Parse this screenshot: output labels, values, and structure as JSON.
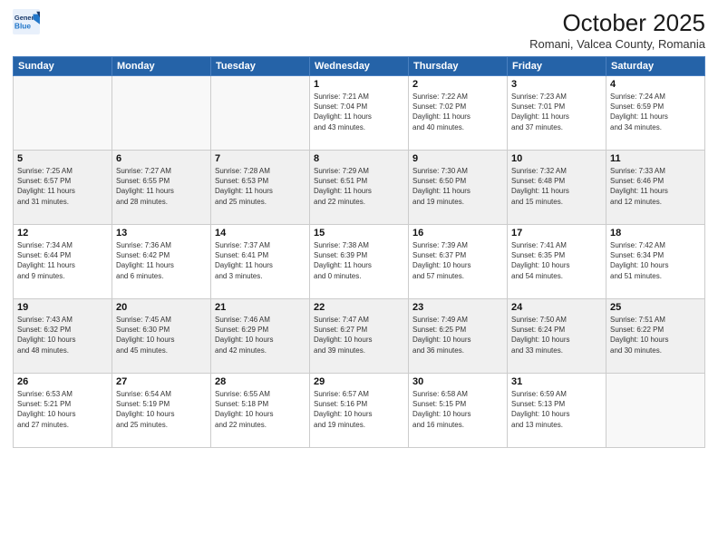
{
  "logo": {
    "line1": "General",
    "line2": "Blue"
  },
  "title": "October 2025",
  "subtitle": "Romani, Valcea County, Romania",
  "weekdays": [
    "Sunday",
    "Monday",
    "Tuesday",
    "Wednesday",
    "Thursday",
    "Friday",
    "Saturday"
  ],
  "weeks": [
    [
      {
        "day": "",
        "info": ""
      },
      {
        "day": "",
        "info": ""
      },
      {
        "day": "",
        "info": ""
      },
      {
        "day": "1",
        "info": "Sunrise: 7:21 AM\nSunset: 7:04 PM\nDaylight: 11 hours\nand 43 minutes."
      },
      {
        "day": "2",
        "info": "Sunrise: 7:22 AM\nSunset: 7:02 PM\nDaylight: 11 hours\nand 40 minutes."
      },
      {
        "day": "3",
        "info": "Sunrise: 7:23 AM\nSunset: 7:01 PM\nDaylight: 11 hours\nand 37 minutes."
      },
      {
        "day": "4",
        "info": "Sunrise: 7:24 AM\nSunset: 6:59 PM\nDaylight: 11 hours\nand 34 minutes."
      }
    ],
    [
      {
        "day": "5",
        "info": "Sunrise: 7:25 AM\nSunset: 6:57 PM\nDaylight: 11 hours\nand 31 minutes."
      },
      {
        "day": "6",
        "info": "Sunrise: 7:27 AM\nSunset: 6:55 PM\nDaylight: 11 hours\nand 28 minutes."
      },
      {
        "day": "7",
        "info": "Sunrise: 7:28 AM\nSunset: 6:53 PM\nDaylight: 11 hours\nand 25 minutes."
      },
      {
        "day": "8",
        "info": "Sunrise: 7:29 AM\nSunset: 6:51 PM\nDaylight: 11 hours\nand 22 minutes."
      },
      {
        "day": "9",
        "info": "Sunrise: 7:30 AM\nSunset: 6:50 PM\nDaylight: 11 hours\nand 19 minutes."
      },
      {
        "day": "10",
        "info": "Sunrise: 7:32 AM\nSunset: 6:48 PM\nDaylight: 11 hours\nand 15 minutes."
      },
      {
        "day": "11",
        "info": "Sunrise: 7:33 AM\nSunset: 6:46 PM\nDaylight: 11 hours\nand 12 minutes."
      }
    ],
    [
      {
        "day": "12",
        "info": "Sunrise: 7:34 AM\nSunset: 6:44 PM\nDaylight: 11 hours\nand 9 minutes."
      },
      {
        "day": "13",
        "info": "Sunrise: 7:36 AM\nSunset: 6:42 PM\nDaylight: 11 hours\nand 6 minutes."
      },
      {
        "day": "14",
        "info": "Sunrise: 7:37 AM\nSunset: 6:41 PM\nDaylight: 11 hours\nand 3 minutes."
      },
      {
        "day": "15",
        "info": "Sunrise: 7:38 AM\nSunset: 6:39 PM\nDaylight: 11 hours\nand 0 minutes."
      },
      {
        "day": "16",
        "info": "Sunrise: 7:39 AM\nSunset: 6:37 PM\nDaylight: 10 hours\nand 57 minutes."
      },
      {
        "day": "17",
        "info": "Sunrise: 7:41 AM\nSunset: 6:35 PM\nDaylight: 10 hours\nand 54 minutes."
      },
      {
        "day": "18",
        "info": "Sunrise: 7:42 AM\nSunset: 6:34 PM\nDaylight: 10 hours\nand 51 minutes."
      }
    ],
    [
      {
        "day": "19",
        "info": "Sunrise: 7:43 AM\nSunset: 6:32 PM\nDaylight: 10 hours\nand 48 minutes."
      },
      {
        "day": "20",
        "info": "Sunrise: 7:45 AM\nSunset: 6:30 PM\nDaylight: 10 hours\nand 45 minutes."
      },
      {
        "day": "21",
        "info": "Sunrise: 7:46 AM\nSunset: 6:29 PM\nDaylight: 10 hours\nand 42 minutes."
      },
      {
        "day": "22",
        "info": "Sunrise: 7:47 AM\nSunset: 6:27 PM\nDaylight: 10 hours\nand 39 minutes."
      },
      {
        "day": "23",
        "info": "Sunrise: 7:49 AM\nSunset: 6:25 PM\nDaylight: 10 hours\nand 36 minutes."
      },
      {
        "day": "24",
        "info": "Sunrise: 7:50 AM\nSunset: 6:24 PM\nDaylight: 10 hours\nand 33 minutes."
      },
      {
        "day": "25",
        "info": "Sunrise: 7:51 AM\nSunset: 6:22 PM\nDaylight: 10 hours\nand 30 minutes."
      }
    ],
    [
      {
        "day": "26",
        "info": "Sunrise: 6:53 AM\nSunset: 5:21 PM\nDaylight: 10 hours\nand 27 minutes."
      },
      {
        "day": "27",
        "info": "Sunrise: 6:54 AM\nSunset: 5:19 PM\nDaylight: 10 hours\nand 25 minutes."
      },
      {
        "day": "28",
        "info": "Sunrise: 6:55 AM\nSunset: 5:18 PM\nDaylight: 10 hours\nand 22 minutes."
      },
      {
        "day": "29",
        "info": "Sunrise: 6:57 AM\nSunset: 5:16 PM\nDaylight: 10 hours\nand 19 minutes."
      },
      {
        "day": "30",
        "info": "Sunrise: 6:58 AM\nSunset: 5:15 PM\nDaylight: 10 hours\nand 16 minutes."
      },
      {
        "day": "31",
        "info": "Sunrise: 6:59 AM\nSunset: 5:13 PM\nDaylight: 10 hours\nand 13 minutes."
      },
      {
        "day": "",
        "info": ""
      }
    ]
  ],
  "colors": {
    "header_bg": "#2563a8",
    "row_shaded": "#f0f0f0",
    "row_white": "#ffffff"
  }
}
